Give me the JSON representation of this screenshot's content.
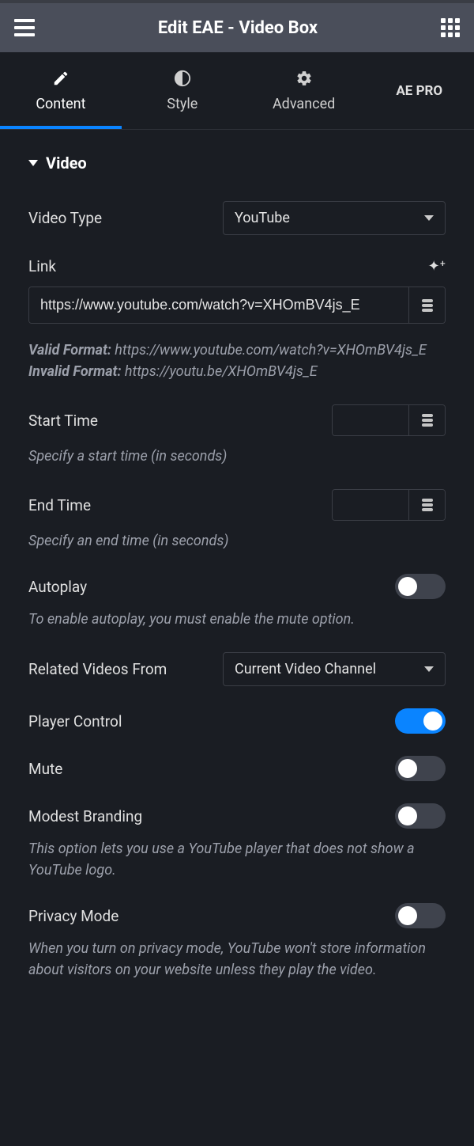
{
  "header": {
    "title": "Edit EAE - Video Box"
  },
  "tabs": {
    "content": "Content",
    "style": "Style",
    "advanced": "Advanced",
    "pro": "AE PRO"
  },
  "section": {
    "title": "Video"
  },
  "fields": {
    "video_type": {
      "label": "Video Type",
      "value": "YouTube"
    },
    "link": {
      "label": "Link",
      "value": "https://www.youtube.com/watch?v=XHOmBV4js_E",
      "help_valid_label": "Valid Format:",
      "help_valid_value": " https://www.youtube.com/watch?v=XHOmBV4js_E",
      "help_invalid_label": "Invalid Format:",
      "help_invalid_value": " https://youtu.be/XHOmBV4js_E"
    },
    "start_time": {
      "label": "Start Time",
      "value": "",
      "help": "Specify a start time (in seconds)"
    },
    "end_time": {
      "label": "End Time",
      "value": "",
      "help": "Specify an end time (in seconds)"
    },
    "autoplay": {
      "label": "Autoplay",
      "help": "To enable autoplay, you must enable the mute option."
    },
    "related": {
      "label": "Related Videos From",
      "value": "Current Video Channel"
    },
    "player_control": {
      "label": "Player Control"
    },
    "mute": {
      "label": "Mute"
    },
    "modest": {
      "label": "Modest Branding",
      "help": "This option lets you use a YouTube player that does not show a YouTube logo."
    },
    "privacy": {
      "label": "Privacy Mode",
      "help": "When you turn on privacy mode, YouTube won't store information about visitors on your website unless they play the video."
    }
  }
}
